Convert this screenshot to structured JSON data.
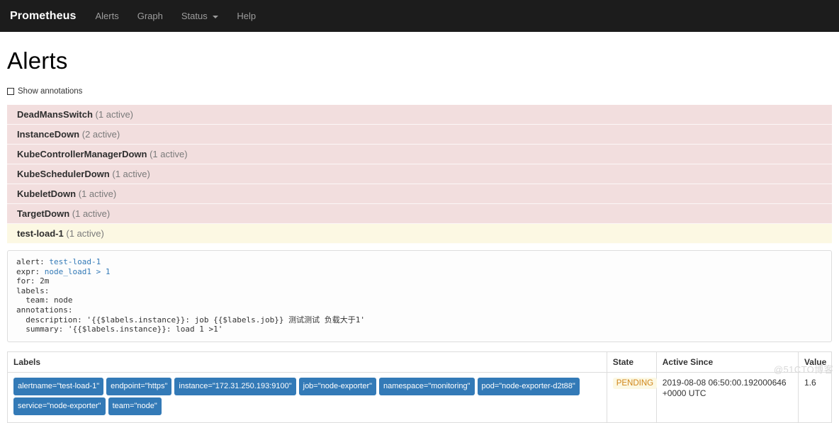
{
  "navbar": {
    "brand": "Prometheus",
    "links": [
      {
        "label": "Alerts",
        "has_caret": false
      },
      {
        "label": "Graph",
        "has_caret": false
      },
      {
        "label": "Status",
        "has_caret": true
      },
      {
        "label": "Help",
        "has_caret": false
      }
    ]
  },
  "page": {
    "title": "Alerts",
    "show_annotations_label": "Show annotations",
    "show_annotations_checked": false
  },
  "alerts": [
    {
      "name": "DeadMansSwitch",
      "count": "(1 active)",
      "state": "firing"
    },
    {
      "name": "InstanceDown",
      "count": "(2 active)",
      "state": "firing"
    },
    {
      "name": "KubeControllerManagerDown",
      "count": "(1 active)",
      "state": "firing"
    },
    {
      "name": "KubeSchedulerDown",
      "count": "(1 active)",
      "state": "firing"
    },
    {
      "name": "KubeletDown",
      "count": "(1 active)",
      "state": "firing"
    },
    {
      "name": "TargetDown",
      "count": "(1 active)",
      "state": "firing"
    },
    {
      "name": "test-load-1",
      "count": "(1 active)",
      "state": "pending"
    }
  ],
  "rule_definition": {
    "lines": [
      {
        "prefix": "alert: ",
        "value": "test-load-1",
        "highlight": true
      },
      {
        "prefix": "expr: ",
        "value": "node_load1 > 1",
        "highlight": true
      },
      {
        "prefix": "for: 2m",
        "value": "",
        "highlight": false
      },
      {
        "prefix": "labels:",
        "value": "",
        "highlight": false
      },
      {
        "prefix": "  team: node",
        "value": "",
        "highlight": false
      },
      {
        "prefix": "annotations:",
        "value": "",
        "highlight": false
      },
      {
        "prefix": "  description: '{{$labels.instance}}: job {{$labels.job}} 测试测试 负载大于1'",
        "value": "",
        "highlight": false
      },
      {
        "prefix": "  summary: '{{$labels.instance}}: load 1 >1'",
        "value": "",
        "highlight": false
      }
    ]
  },
  "table": {
    "headers": {
      "labels": "Labels",
      "state": "State",
      "active_since": "Active Since",
      "value": "Value"
    },
    "rows": [
      {
        "labels": [
          "alertname=\"test-load-1\"",
          "endpoint=\"https\"",
          "instance=\"172.31.250.193:9100\"",
          "job=\"node-exporter\"",
          "namespace=\"monitoring\"",
          "pod=\"node-exporter-d2t88\"",
          "service=\"node-exporter\"",
          "team=\"node\""
        ],
        "state": "PENDING",
        "active_since": "2019-08-08 06:50:00.192000646 +0000 UTC",
        "value": "1.6"
      }
    ]
  },
  "watermark": "@51CTO博客",
  "colors": {
    "navbar_bg": "#1c1c1c",
    "firing_row": "#f2dede",
    "pending_row": "#fcf8e3",
    "label_badge": "#337ab7",
    "pending_text": "#d1861a",
    "code_link": "#337ab7"
  }
}
